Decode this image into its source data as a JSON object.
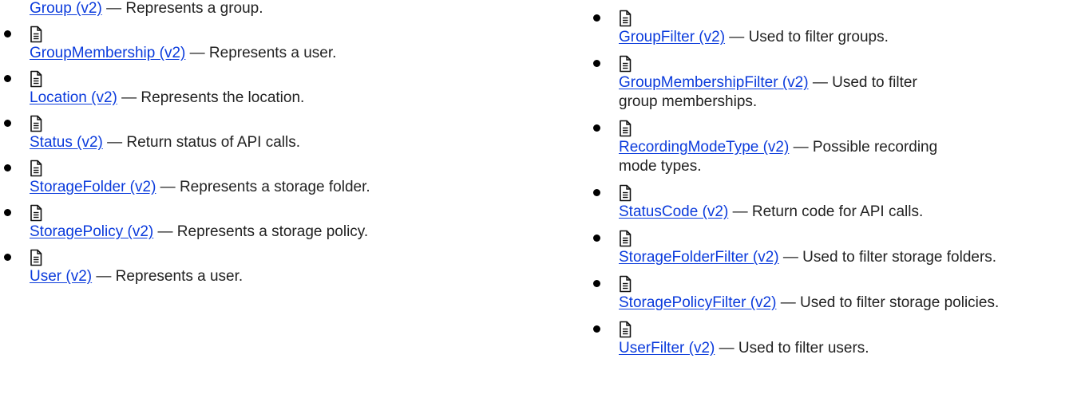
{
  "left_column": [
    {
      "link": "Group (v2)",
      "desc": " — Represents a group.",
      "icon": false
    },
    {
      "link": "GroupMembership (v2)",
      "desc": " — Represents a user.",
      "icon": true
    },
    {
      "link": "Location (v2)",
      "desc": " — Represents the location.",
      "icon": true
    },
    {
      "link": "Status (v2)",
      "desc": " — Return status of API calls.",
      "icon": true
    },
    {
      "link": "StorageFolder (v2)",
      "desc": " — Represents a storage folder.",
      "icon": true
    },
    {
      "link": "StoragePolicy (v2)",
      "desc": " — Represents a storage policy.",
      "icon": true
    },
    {
      "link": "User (v2)",
      "desc": " — Represents a user.",
      "icon": true
    }
  ],
  "right_column": [
    {
      "link": "GroupFilter (v2)",
      "desc": " — Used to filter groups.",
      "icon": true
    },
    {
      "link": "GroupMembershipFilter (v2)",
      "desc": " — Used to filter group memberships.",
      "icon": true
    },
    {
      "link": "RecordingModeType (v2)",
      "desc": " — Possible recording mode types.",
      "icon": true
    },
    {
      "link": "StatusCode (v2)",
      "desc": " — Return code for API calls.",
      "icon": true
    },
    {
      "link": "StorageFolderFilter (v2)",
      "desc": " — Used to filter storage folders.",
      "icon": true
    },
    {
      "link": "StoragePolicyFilter (v2)",
      "desc": " — Used to filter storage policies.",
      "icon": true
    },
    {
      "link": "UserFilter (v2)",
      "desc": " — Used to filter users.",
      "icon": true
    }
  ],
  "icon_name": "document-icon",
  "colors": {
    "link": "#0b3bdc",
    "text": "#222222",
    "bullet": "#000000"
  }
}
